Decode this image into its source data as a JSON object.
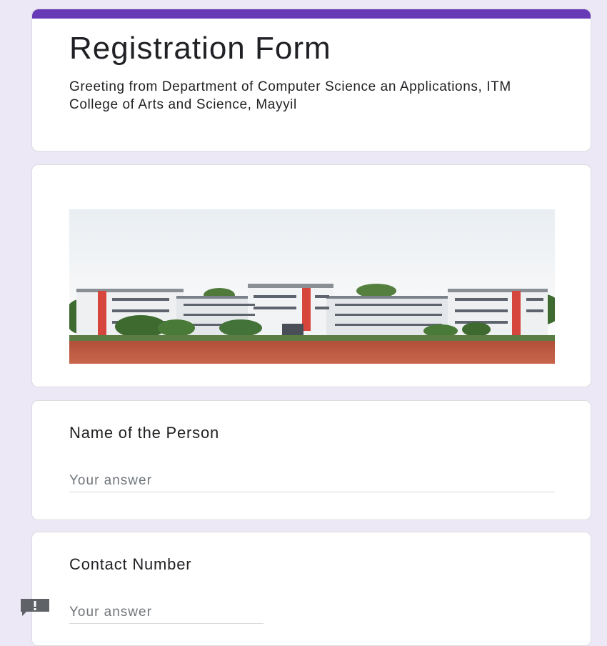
{
  "form": {
    "title": "Registration Form",
    "description": "Greeting from Department of Computer Science an Applications, ITM College of Arts and Science, Mayyil",
    "accent_color": "#673ab7",
    "background_color": "#ede8f6"
  },
  "header_image": {
    "icon": "college-building-photo"
  },
  "questions": [
    {
      "label": "Name of the Person",
      "placeholder": "Your answer",
      "value": ""
    },
    {
      "label": "Contact Number",
      "placeholder": "Your answer",
      "value": ""
    }
  ],
  "feedback": {
    "icon": "report-feedback-icon"
  }
}
